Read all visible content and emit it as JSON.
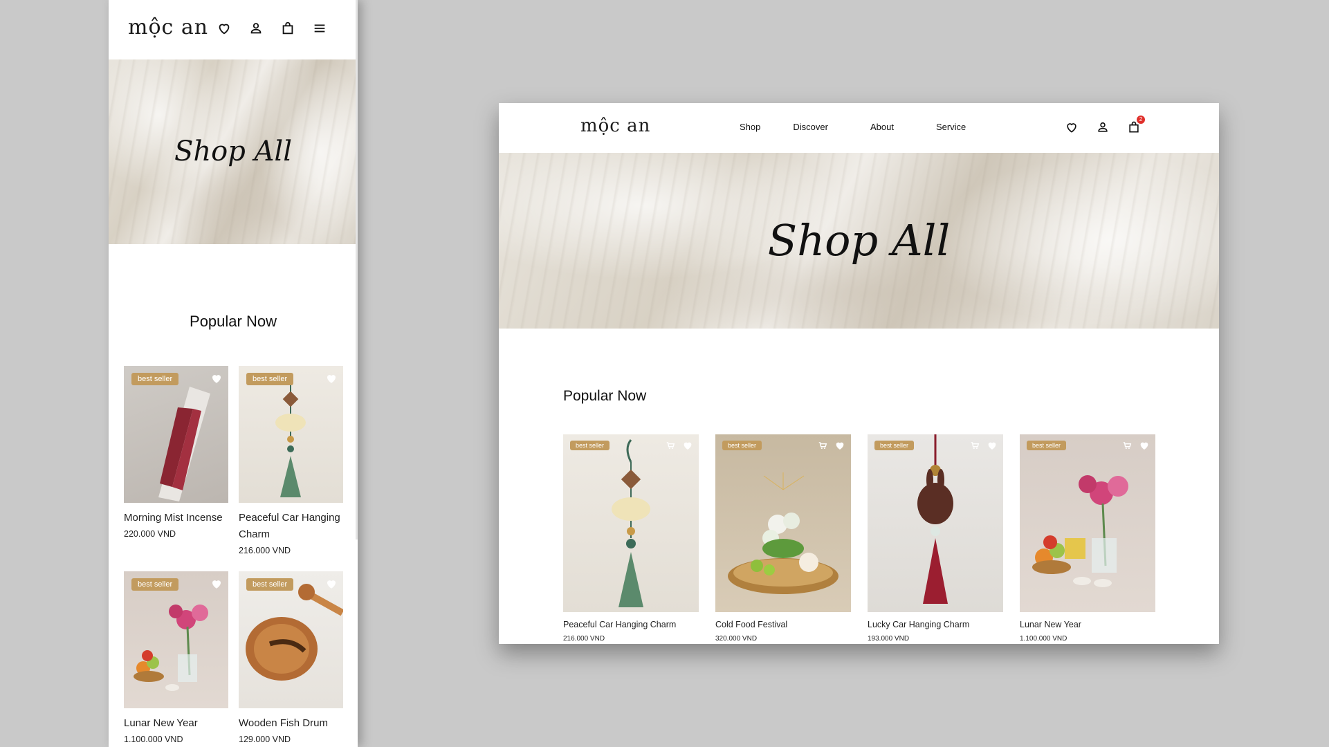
{
  "brand": {
    "logo_text": "mộc an"
  },
  "mobile": {
    "hero_title": "Shop All",
    "section_title": "Popular Now",
    "products": [
      {
        "name": "Morning Mist Incense",
        "price": "220.000 VND",
        "badge": "best seller",
        "image": "incense-box"
      },
      {
        "name": "Peaceful Car Hanging Charm",
        "price": "216.000 VND",
        "badge": "best seller",
        "image": "lotus-charm"
      },
      {
        "name": "Lunar New Year",
        "price": "1.100.000 VND",
        "badge": "best seller",
        "image": "flowers-fruit"
      },
      {
        "name": "Wooden Fish Drum",
        "price": "129.000 VND",
        "badge": "best seller",
        "image": "wooden-drum"
      }
    ]
  },
  "desktop": {
    "nav": [
      "Shop",
      "Discover",
      "About",
      "Service"
    ],
    "cart_count": "2",
    "hero_title": "Shop All",
    "section_title": "Popular Now",
    "products": [
      {
        "name": "Peaceful Car Hanging Charm",
        "price": "216.000 VND",
        "badge": "best seller",
        "image": "lotus-charm"
      },
      {
        "name": "Cold Food Festival",
        "price": "320.000 VND",
        "badge": "best seller",
        "image": "lotus-tray"
      },
      {
        "name": "Lucky Car Hanging Charm",
        "price": "193.000 VND",
        "badge": "best seller",
        "image": "rabbit-charm"
      },
      {
        "name": "Lunar New Year",
        "price": "1.100.000 VND",
        "badge": "best seller",
        "image": "flowers-fruit"
      }
    ]
  },
  "colors": {
    "badge": "#c29b5e",
    "accent_red": "#e0302b",
    "backdrop": "#c9c9c9"
  }
}
